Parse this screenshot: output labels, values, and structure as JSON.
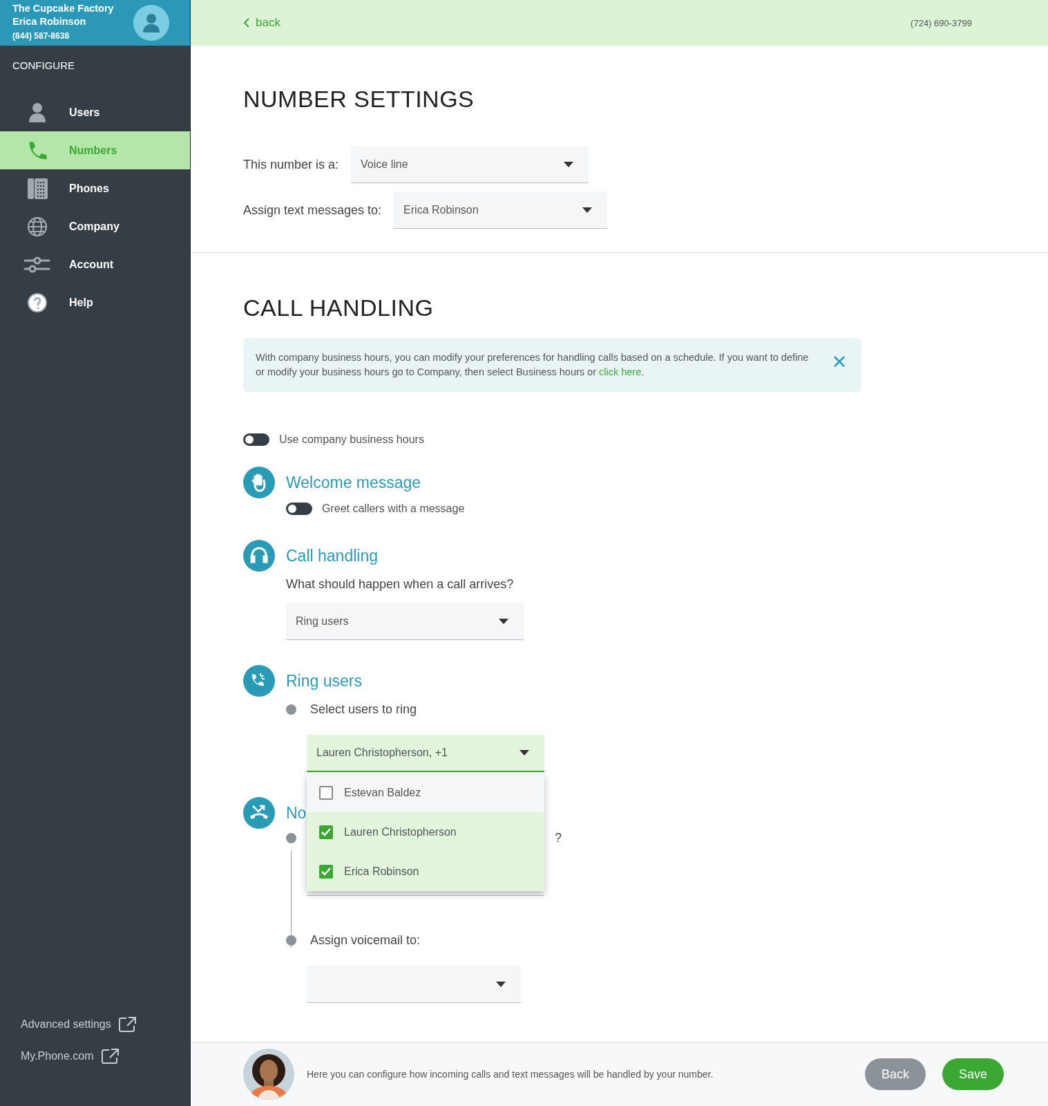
{
  "account": {
    "company": "The Cupcake Factory",
    "user": "Erica Robinson",
    "phone": "(844) 587-8638"
  },
  "sidebar": {
    "heading": "CONFIGURE",
    "items": [
      {
        "label": "Users",
        "selected": false
      },
      {
        "label": "Numbers",
        "selected": true
      },
      {
        "label": "Phones",
        "selected": false
      },
      {
        "label": "Company",
        "selected": false
      },
      {
        "label": "Account",
        "selected": false
      },
      {
        "label": "Help",
        "selected": false
      }
    ],
    "links": [
      {
        "label": "Advanced settings"
      },
      {
        "label": "My.Phone.com"
      }
    ]
  },
  "topbar": {
    "back": "back",
    "phone": "(724) 690-3799"
  },
  "number_settings": {
    "title": "NUMBER SETTINGS",
    "fields": [
      {
        "label": "This number is a:",
        "value": "Voice line"
      },
      {
        "label": "Assign text messages to:",
        "value": "Erica Robinson"
      }
    ]
  },
  "call_handling": {
    "title": "CALL HANDLING",
    "notice": {
      "text": "With company business hours, you can modify your preferences for handling calls based on a schedule. If you want to define or modify your business hours go to Company, then select Business hours or ",
      "link": "click here",
      "end": "."
    },
    "business_hours": {
      "label": "Use company business hours",
      "on": false
    },
    "sections": [
      {
        "kind": "toggle",
        "title": "Welcome message",
        "toggle": {
          "label": "Greet callers with a message",
          "on": false
        }
      },
      {
        "kind": "select",
        "title": "Call handling",
        "question": "What should happen when a call arrives?",
        "value": "Ring users"
      },
      {
        "kind": "ring",
        "title": "Ring users",
        "step": "Select users to ring",
        "value": "Lauren Christopherson, +1",
        "expanded": true,
        "options": [
          {
            "label": "Estevan Baldez",
            "checked": false
          },
          {
            "label": "Lauren Christopherson",
            "checked": true
          },
          {
            "label": "Erica Robinson",
            "checked": true
          }
        ]
      },
      {
        "kind": "steps",
        "title": "No",
        "question": "?",
        "step": "Assign voicemail to:"
      }
    ]
  },
  "footer": {
    "message": "Here you can configure how incoming calls and text messages will be handled by your number.",
    "buttons": [
      {
        "label": "Back",
        "kind": "secondary"
      },
      {
        "label": "Save",
        "kind": "primary"
      }
    ]
  }
}
